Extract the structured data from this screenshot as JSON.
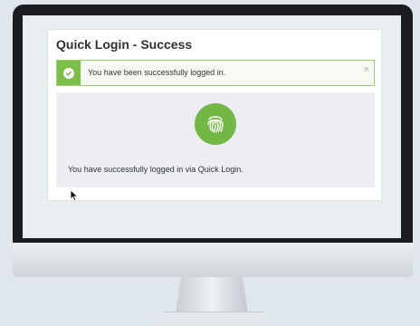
{
  "panel": {
    "title": "Quick Login - Success"
  },
  "alert": {
    "message": "You have been successfully logged in.",
    "close_glyph": "×",
    "icon": "check-circle-icon",
    "accent": "#7cbf48"
  },
  "content": {
    "icon": "fingerprint-icon",
    "message": "You have successfully logged in via Quick Login."
  }
}
